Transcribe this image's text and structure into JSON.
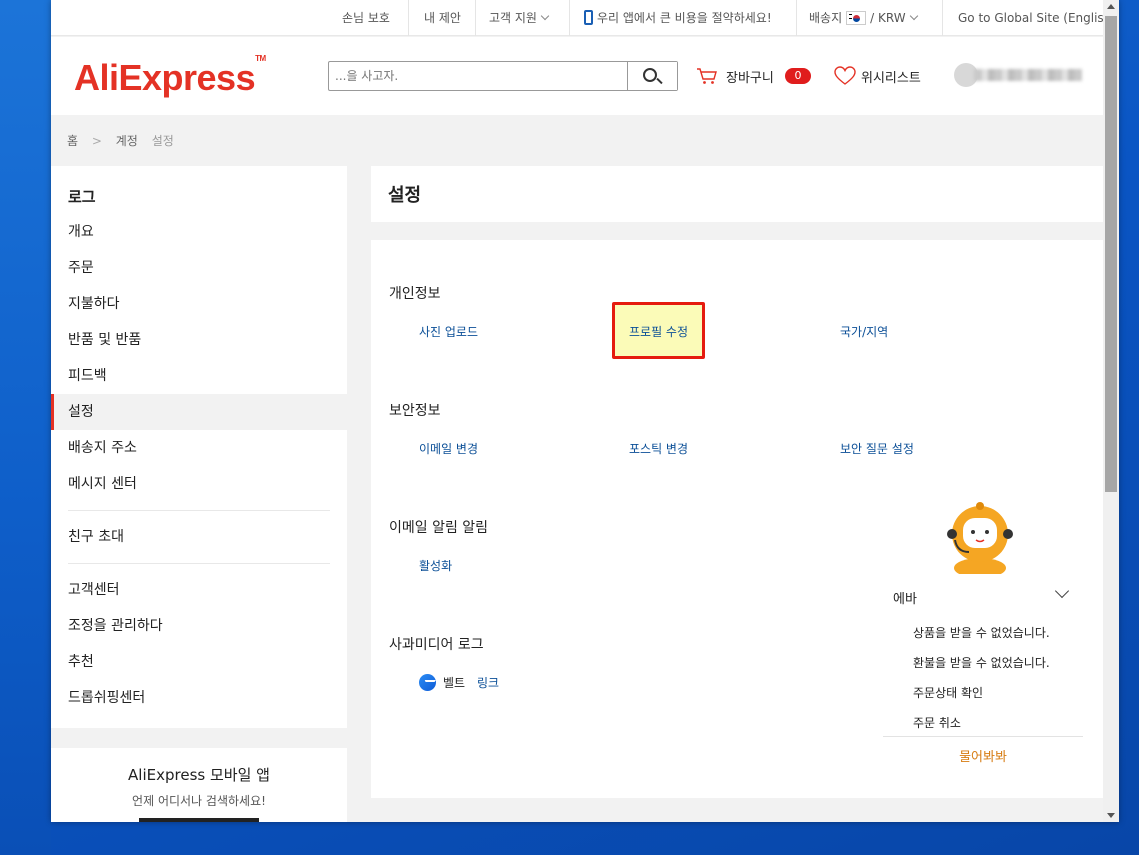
{
  "topbar": {
    "buyer_protection": "손님 보호",
    "my_suggestion": "내 제안",
    "customer_support": "고객 지원",
    "app_promo": "우리 앱에서 큰 비용을 절약하세요!",
    "ship_to_label": "배송지",
    "currency": "/ KRW",
    "global_site": "Go to Global Site (English)"
  },
  "header": {
    "logo": "AliExpress",
    "search_placeholder": "...을 사고자.",
    "cart_label": "장바구니",
    "cart_count": "0",
    "wishlist_label": "위시리스트"
  },
  "breadcrumb": [
    "홈",
    ">",
    "계정",
    "설정"
  ],
  "sidebar": {
    "title": "로그",
    "items": [
      {
        "label": "개요"
      },
      {
        "label": "주문"
      },
      {
        "label": "지불하다"
      },
      {
        "label": "반품 및 반품"
      },
      {
        "label": "피드백"
      },
      {
        "label": "설정",
        "active": true
      },
      {
        "label": "배송지 주소"
      },
      {
        "label": "메시지 센터"
      }
    ],
    "invite": "친구 초대",
    "group2": [
      {
        "label": "고객센터"
      },
      {
        "label": "조정을 관리하다"
      },
      {
        "label": "추천"
      },
      {
        "label": "드롭쉬핑센터"
      }
    ],
    "app": {
      "title": "AliExpress 모바일 앱",
      "subtitle": "언제 어디서나 검색하세요!"
    }
  },
  "main": {
    "title": "설정",
    "personal": {
      "title": "개인정보",
      "upload_photo": "사진 업로드",
      "edit_profile": "프로필 수정",
      "country_region": "국가/지역"
    },
    "security": {
      "title": "보안정보",
      "change_email": "이메일 변경",
      "change_password": "포스틱 변경",
      "security_question": "보안 질문 설정"
    },
    "email_alert": {
      "title": "이메일 알림 알림",
      "activate": "활성화"
    },
    "social": {
      "title": "사과미디어 로그",
      "name": "벨트",
      "link": "링크"
    }
  },
  "chatbot": {
    "name": "에바",
    "options": [
      "상품을 받을 수 없었습니다.",
      "환불을 받을 수 없었습니다.",
      "주문상태 확인",
      "주문 취소"
    ],
    "ask": "물어봐봐"
  },
  "colors": {
    "brand": "#e43225",
    "link": "#0b4f97",
    "highlight_border": "#e51b0e",
    "highlight_fill": "#fbfbb8",
    "chat_ask": "#d77d14"
  }
}
